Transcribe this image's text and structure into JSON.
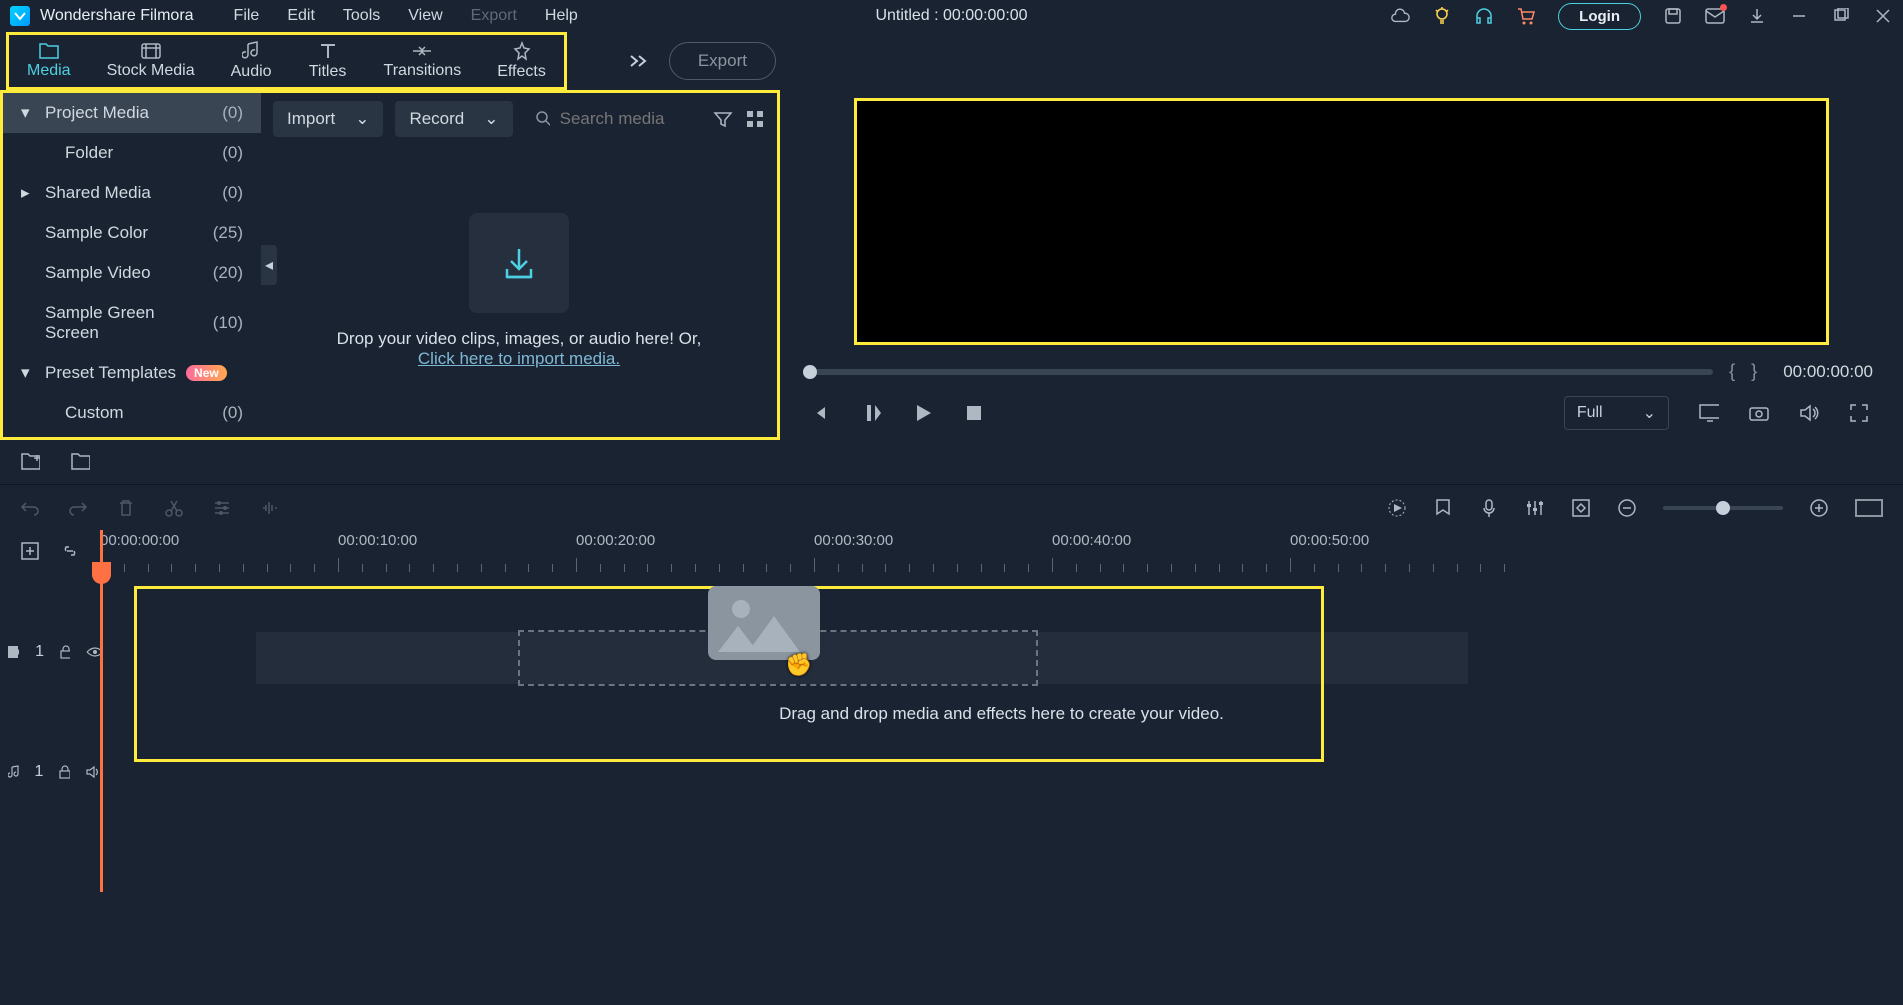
{
  "app": {
    "name": "Wondershare Filmora"
  },
  "menu": {
    "file": "File",
    "edit": "Edit",
    "tools": "Tools",
    "view": "View",
    "export": "Export",
    "help": "Help"
  },
  "title": {
    "doc": "Untitled : 00:00:00:00"
  },
  "login": {
    "label": "Login"
  },
  "tabs": {
    "media": "Media",
    "stock": "Stock Media",
    "audio": "Audio",
    "titles": "Titles",
    "transitions": "Transitions",
    "effects": "Effects"
  },
  "export_btn": "Export",
  "sidebar": {
    "items": [
      {
        "label": "Project Media",
        "count": "(0)"
      },
      {
        "label": "Folder",
        "count": "(0)"
      },
      {
        "label": "Shared Media",
        "count": "(0)"
      },
      {
        "label": "Sample Color",
        "count": "(25)"
      },
      {
        "label": "Sample Video",
        "count": "(20)"
      },
      {
        "label": "Sample Green Screen",
        "count": "(10)"
      },
      {
        "label": "Preset Templates",
        "count": ""
      },
      {
        "label": "Custom",
        "count": "(0)"
      }
    ],
    "new_badge": "New"
  },
  "media_toolbar": {
    "import": "Import",
    "record": "Record",
    "search_placeholder": "Search media"
  },
  "media_drop": {
    "line1": "Drop your video clips, images, or audio here! Or,",
    "link": "Click here to import media."
  },
  "preview": {
    "brace_open": "{",
    "brace_close": "}",
    "timecode": "00:00:00:00",
    "quality": "Full"
  },
  "ruler": {
    "labels": [
      "00:00:00:00",
      "00:00:10:00",
      "00:00:20:00",
      "00:00:30:00",
      "00:00:40:00",
      "00:00:50:00"
    ]
  },
  "tracks": {
    "video_label": "1",
    "audio_label": "1",
    "drop_hint": "Drag and drop media and effects here to create your video."
  }
}
